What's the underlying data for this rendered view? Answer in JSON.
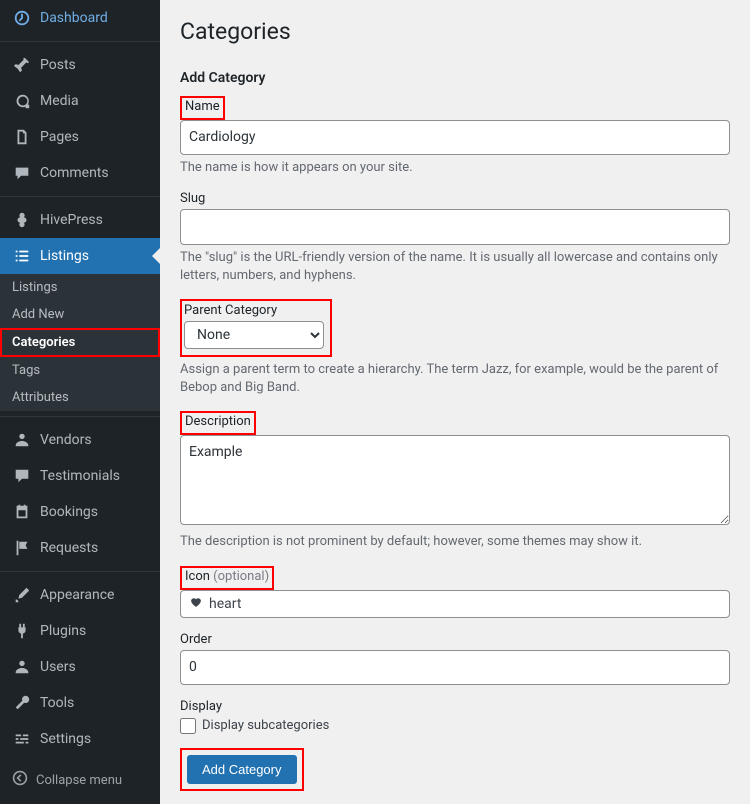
{
  "page": {
    "title": "Categories",
    "form_heading": "Add Category"
  },
  "sidebar": {
    "items": [
      {
        "label": "Dashboard"
      },
      {
        "label": "Posts"
      },
      {
        "label": "Media"
      },
      {
        "label": "Pages"
      },
      {
        "label": "Comments"
      },
      {
        "label": "HivePress"
      },
      {
        "label": "Listings"
      },
      {
        "label": "Vendors"
      },
      {
        "label": "Testimonials"
      },
      {
        "label": "Bookings"
      },
      {
        "label": "Requests"
      },
      {
        "label": "Appearance"
      },
      {
        "label": "Plugins"
      },
      {
        "label": "Users"
      },
      {
        "label": "Tools"
      },
      {
        "label": "Settings"
      }
    ],
    "submenu": [
      {
        "label": "Listings"
      },
      {
        "label": "Add New"
      },
      {
        "label": "Categories"
      },
      {
        "label": "Tags"
      },
      {
        "label": "Attributes"
      }
    ],
    "collapse_label": "Collapse menu"
  },
  "form": {
    "name_label": "Name",
    "name_value": "Cardiology",
    "name_help": "The name is how it appears on your site.",
    "slug_label": "Slug",
    "slug_value": "",
    "slug_help": "The \"slug\" is the URL-friendly version of the name. It is usually all lowercase and contains only letters, numbers, and hyphens.",
    "parent_label": "Parent Category",
    "parent_value": "None",
    "parent_help": "Assign a parent term to create a hierarchy. The term Jazz, for example, would be the parent of Bebop and Big Band.",
    "desc_label": "Description",
    "desc_value": "Example",
    "desc_help": "The description is not prominent by default; however, some themes may show it.",
    "icon_label": "Icon",
    "icon_opt": " (optional)",
    "icon_value": "heart",
    "order_label": "Order",
    "order_value": "0",
    "display_label": "Display",
    "display_check_label": "Display subcategories",
    "submit_label": "Add Category"
  }
}
